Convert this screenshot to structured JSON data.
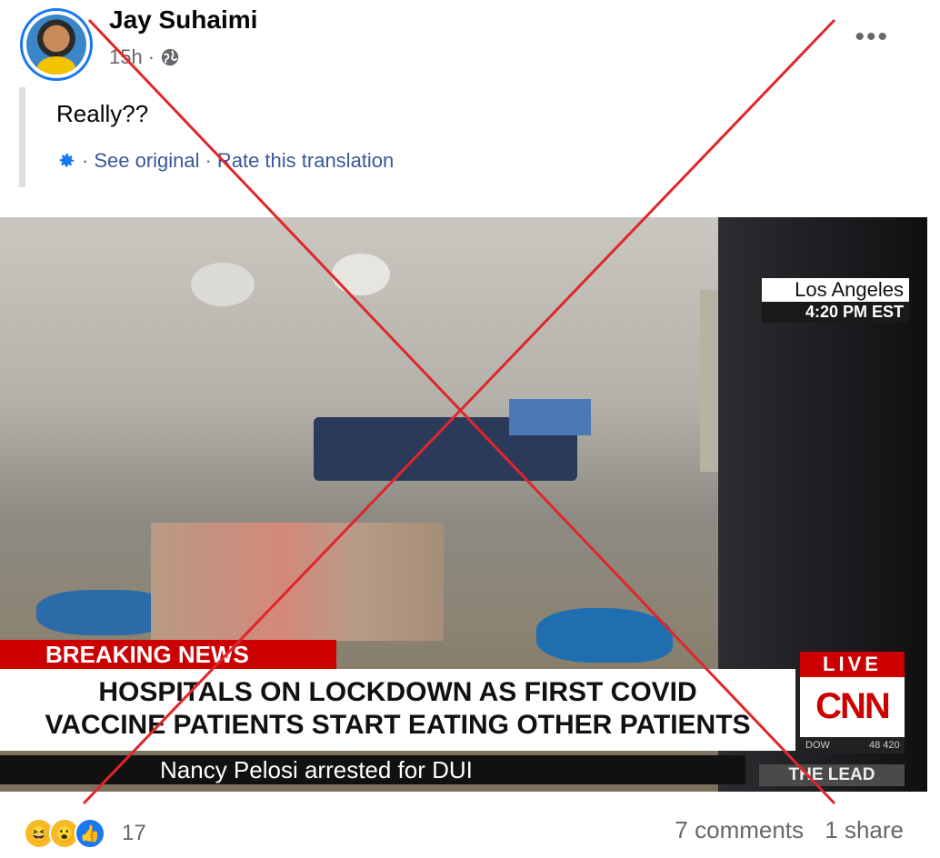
{
  "post": {
    "author": "Jay Suhaimi",
    "time": "15h",
    "time_separator": "·",
    "privacy_icon": "globe-icon",
    "more_label": "•••",
    "text": "Really??",
    "translation": {
      "settings_icon": "gear-icon",
      "separator1": "·",
      "see_original": "See original",
      "separator2": "·",
      "rate": "Rate this translation"
    }
  },
  "image": {
    "location": "Los Angeles",
    "time": "4:20 PM EST",
    "breaking": "BREAKING NEWS",
    "headline_line1": "HOSPITALS ON LOCKDOWN AS FIRST COVID",
    "headline_line2": "VACCINE PATIENTS START EATING OTHER PATIENTS",
    "ticker": "Nancy Pelosi arrested for DUI",
    "live": "LIVE",
    "network": "CNN",
    "dow": "DOW",
    "dow_value": "48 420",
    "show": "THE LEAD"
  },
  "footer": {
    "reaction_icons": [
      "haha-icon",
      "wow-icon",
      "like-icon"
    ],
    "reaction_count": "17",
    "comments": "7 comments",
    "shares": "1 share"
  },
  "overlay": {
    "color": "#e0262b"
  }
}
